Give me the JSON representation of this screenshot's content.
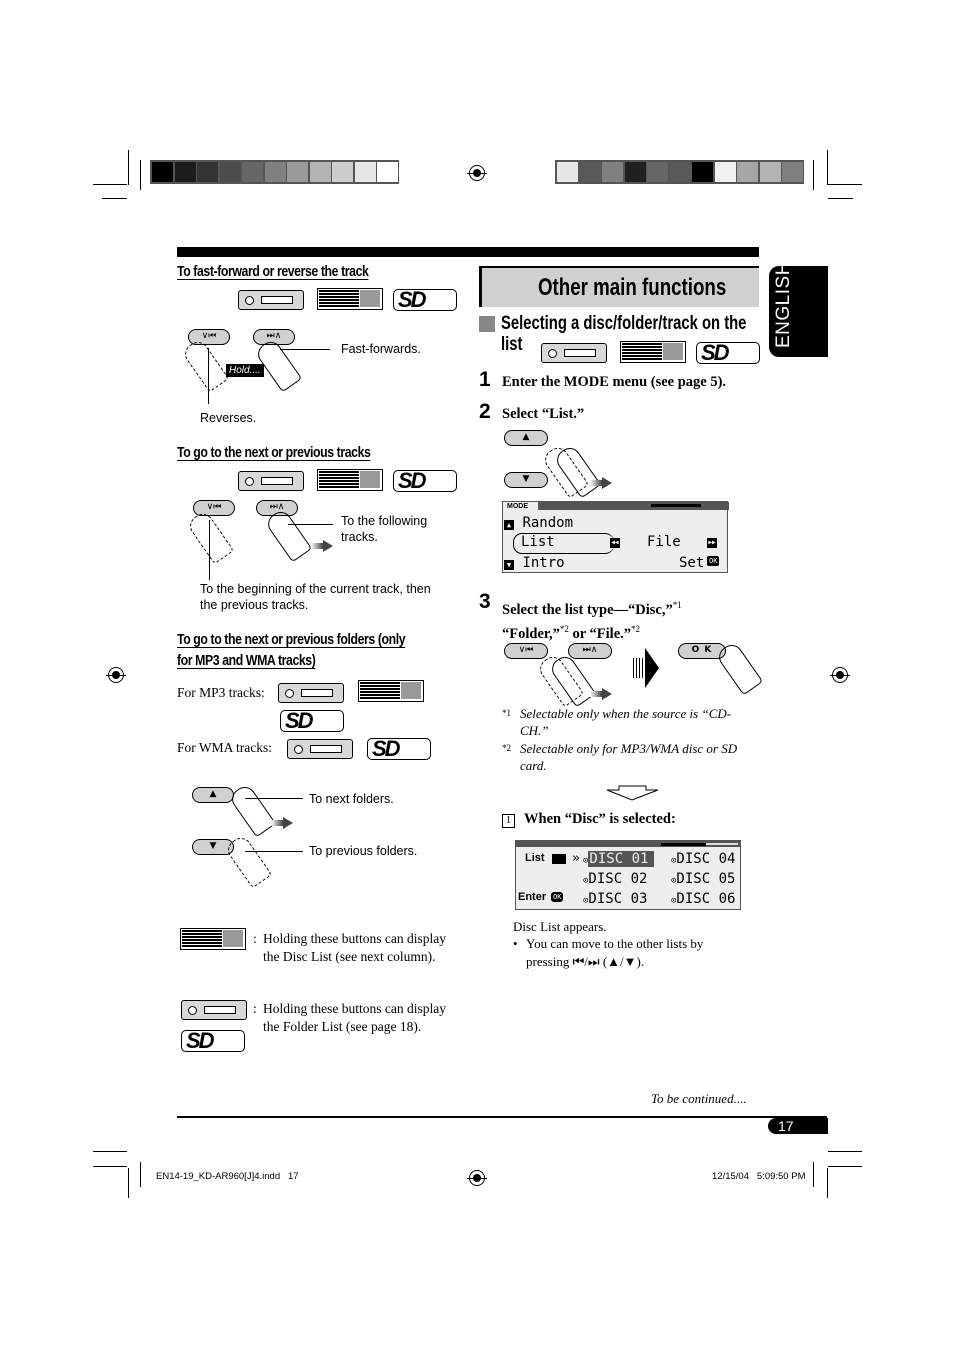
{
  "printer_marks": {
    "left_color_bar": [
      "#000000",
      "#1c1c1c",
      "#333333",
      "#4d4d4d",
      "#666666",
      "#808080",
      "#999999",
      "#b3b3b3",
      "#cccccc",
      "#e6e6e6",
      "#ffffff"
    ],
    "right_color_bar": [
      "#e6e6e6",
      "#595959",
      "#808080",
      "#1f1f1f",
      "#666666",
      "#595959",
      "#000000",
      "#f2f2f2",
      "#a6a6a6",
      "#b3b3b3",
      "#808080"
    ]
  },
  "left_column": {
    "section1": {
      "heading": "To fast-forward or reverse the track",
      "button_prev": "∨⏮",
      "button_next": "⏭∧",
      "hold_badge": "Hold....",
      "callout_fast_forward": "Fast-forwards.",
      "callout_reverse": "Reverses."
    },
    "section2": {
      "heading": "To go to the next or previous tracks",
      "button_prev": "∨⏮",
      "button_next": "⏭∧",
      "callout_next": "To the following tracks.",
      "callout_prev": "To the beginning of the current track, then the previous tracks."
    },
    "section3": {
      "heading_line1": "To go to the next or previous folders (only",
      "heading_line2": "for MP3 and WMA tracks)",
      "mp3_label": "For MP3 tracks:",
      "wma_label": "For WMA tracks:",
      "button_up": "▲",
      "button_down": "▼",
      "callout_next": "To next folders.",
      "callout_prev": "To previous folders."
    },
    "notes": [
      {
        "sep": ":",
        "text": "Holding these buttons can display the Disc List (see next column)."
      },
      {
        "sep": ":",
        "text": "Holding these buttons can display the Folder List (see page 18)."
      }
    ]
  },
  "right_column": {
    "title": "Other main functions",
    "subsection_title_line1": "Selecting a disc/folder/track on the",
    "subsection_title_line2": "list",
    "steps": [
      {
        "num": "1",
        "text": "Enter the MODE menu (see page 5)."
      },
      {
        "num": "2",
        "text": "Select “List.”"
      },
      {
        "num": "3",
        "text_a": "Select the list type—“Disc,”",
        "sup_a": "*1",
        "text_b": "“Folder,”",
        "sup_b": "*2",
        "text_c": " or “File.”",
        "sup_c": "*2"
      }
    ],
    "mode_lcd": {
      "tab": "MODE",
      "row1": "Random",
      "row2": "List",
      "row3": "Intro",
      "right_top": "File",
      "right_bottom": "Set",
      "ok_badge": "OK"
    },
    "step3_buttons": {
      "prev": "∨⏮",
      "next": "⏭∧",
      "ok": "O K"
    },
    "footnotes": [
      {
        "mark": "*1",
        "text": "Selectable only when the source is “CD-CH.”"
      },
      {
        "mark": "*2",
        "text": "Selectable only for MP3/WMA disc or SD card."
      }
    ],
    "case1": {
      "box": "1",
      "label": "When “Disc” is selected:"
    },
    "disc_lcd": {
      "left_top": "List",
      "left_bottom": "Enter",
      "ok_badge": "OK",
      "discs": [
        "DISC 01",
        "DISC 02",
        "DISC 03",
        "DISC 04",
        "DISC 05",
        "DISC 06"
      ],
      "selected": "DISC 01"
    },
    "after_text": "Disc List appears.",
    "bullet": "You can move to the other lists by pressing ⏮/⏭ (▲/▼)."
  },
  "side_tab": "ENGLISH",
  "footer": {
    "continued": "To be continued....",
    "page_number": "17",
    "file_slug": "EN14-19_KD-AR960[J]4.indd   17",
    "timestamp": "12/15/04   5:09:50 PM"
  }
}
